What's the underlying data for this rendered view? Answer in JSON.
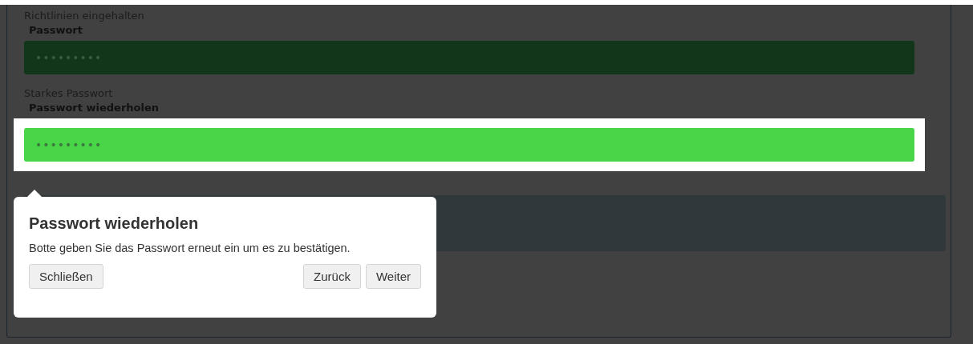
{
  "fields": [
    {
      "status": "Richtlinien eingehalten",
      "label": "Passwort",
      "value": "•••••••••",
      "highlighted": false
    },
    {
      "status": "Starkes Passwort",
      "label": "Passwort wiederholen",
      "value": "•••••••••",
      "highlighted": true
    }
  ],
  "tour_popover": {
    "title": "Passwort wiederholen",
    "text": "Botte geben Sie das Passwort erneut ein um es zu bestätigen.",
    "buttons": [
      {
        "label": "Schließen",
        "kind": "close"
      },
      {
        "label": "Zurück",
        "kind": "prev"
      },
      {
        "label": "Weiter",
        "kind": "next"
      }
    ]
  }
}
